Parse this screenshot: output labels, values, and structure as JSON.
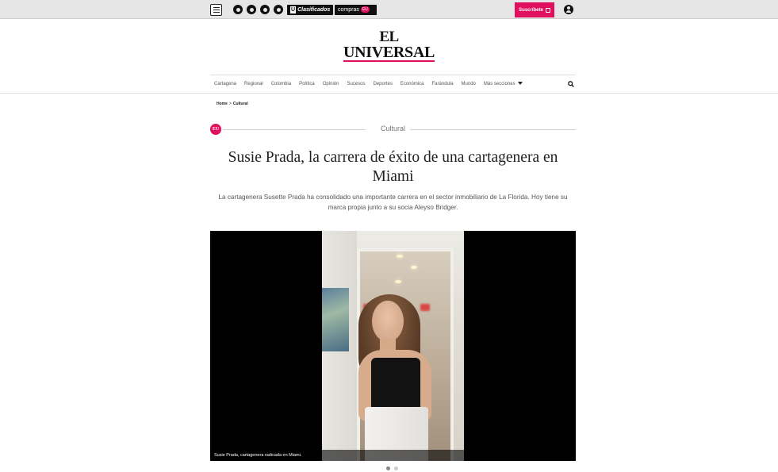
{
  "topbar": {
    "menu_icon": "hamburger-icon",
    "social_icons": [
      "instagram-icon",
      "facebook-icon",
      "twitter-icon",
      "youtube-icon"
    ],
    "clasificados": {
      "mark": "U",
      "label": "Clasificados"
    },
    "compras": {
      "label": "compras",
      "tag": "EU"
    },
    "subscribe_label": "Suscríbete",
    "user_icon": "user-icon"
  },
  "logo": {
    "line1": "EL",
    "line2": "UNIVERSAL",
    "accent": "#e0105e"
  },
  "nav": {
    "items": [
      "Cartagena",
      "Regional",
      "Colombia",
      "Política",
      "Opinión",
      "Sucesos",
      "Deportes",
      "Económica",
      "Farándula",
      "Mundo"
    ],
    "more_label": "Más secciones",
    "search_icon": "search-icon"
  },
  "breadcrumb": {
    "home": "Home",
    "separator": ">",
    "current": "Cultural"
  },
  "section": {
    "badge": "EU",
    "name": "Cultural"
  },
  "article": {
    "headline": "Susie Prada, la carrera de éxito de una cartagenera en Miami",
    "lead": "La cartagenera Susette Prada ha consolidado una importante carrera en el sector inmobiliario de La Florida. Hoy tiene su marca propia junto a su socia Aleyso Bridger.",
    "caption": "Susie Prada, cartagenera radicada en Miami."
  },
  "gallery": {
    "slides": 2,
    "current": 1
  }
}
